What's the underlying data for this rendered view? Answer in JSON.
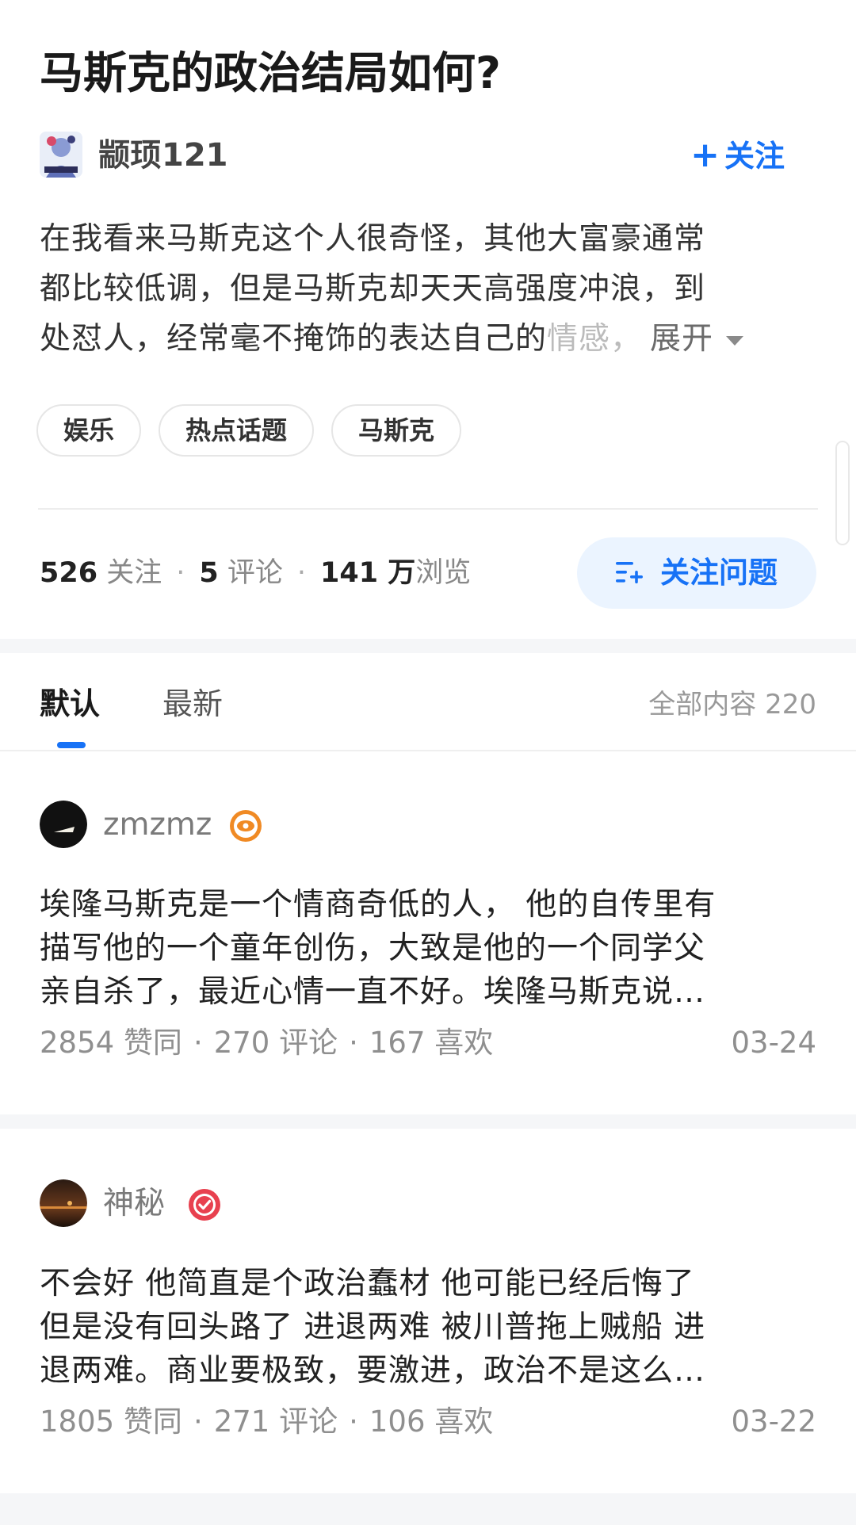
{
  "question": {
    "title": "马斯克的政治结局如何?",
    "author_name": "颛顼121",
    "follow_author_label": "关注",
    "description_lines": [
      "在我看来马斯克这个人很奇怪，其他大富豪通常",
      "都比较低调，但是马斯克却天天高强度冲浪，到",
      "处怼人，经常毫不掩饰的表达自己的"
    ],
    "description_fade": "情感，",
    "expand_label": "展开",
    "tags": [
      "娱乐",
      "热点话题",
      "马斯克"
    ],
    "stats": {
      "followers_count": "526",
      "followers_label": "关注",
      "comments_count": "5",
      "comments_label": "评论",
      "views_count": "141 万",
      "views_label": "浏览"
    },
    "follow_question_label": "关注问题"
  },
  "tabs": {
    "items": [
      "默认",
      "最新"
    ],
    "active": "默认",
    "total_label": "全部内容 220"
  },
  "answers": [
    {
      "author": "zmzmz",
      "badge_icon": "orange-eye-badge-icon",
      "lines": [
        "埃隆马斯克是一个情商奇低的人， 他的自传里有",
        "描写他的一个童年创伤，大致是他的一个同学父",
        "亲自杀了，最近心情一直不好。埃隆马斯克说…"
      ],
      "likes": "2854",
      "likes_label": "赞同",
      "comments": "270",
      "comments_label": "评论",
      "favorites": "167",
      "favorites_label": "喜欢",
      "date": "03-24"
    },
    {
      "author": "神秘",
      "badge_icon": "red-check-badge-icon",
      "lines": [
        "不会好 他简直是个政治蠢材 他可能已经后悔了",
        "但是没有回头路了 进退两难 被川普拖上贼船 进",
        "退两难。商业要极致，要激进，政治不是这么…"
      ],
      "likes": "1805",
      "likes_label": "赞同",
      "comments": "271",
      "comments_label": "评论",
      "favorites": "106",
      "favorites_label": "喜欢",
      "date": "03-22"
    }
  ],
  "colors": {
    "accent": "#1772f6",
    "accent_bg": "#ebf4ff",
    "badge_orange": "#f08a24",
    "badge_red": "#e8414f",
    "separator_band": "#f5f6f8"
  }
}
